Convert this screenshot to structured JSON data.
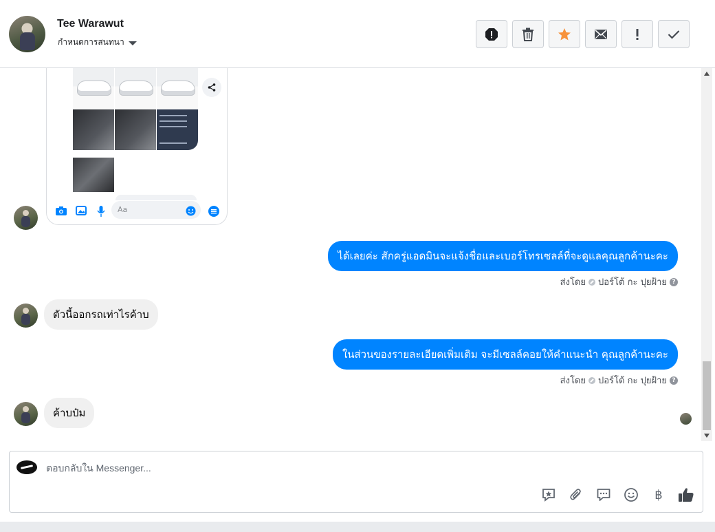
{
  "header": {
    "name": "Tee Warawut",
    "subtitle": "กำหนดการสนทนา",
    "tools": [
      {
        "icon": "alert-icon"
      },
      {
        "icon": "trash-icon"
      },
      {
        "icon": "star-icon",
        "color": "#f7923b"
      },
      {
        "icon": "envelope-icon"
      },
      {
        "icon": "exclamation-icon"
      },
      {
        "icon": "checkmark-icon"
      }
    ]
  },
  "attachment": {
    "input_placeholder": "Aa"
  },
  "messages": [
    {
      "direction": "out",
      "text": "ได้เลยค่ะ สักครู่แอดมินจะแจ้งชื่อและเบอร์โทรเซลล์ที่จะดูแลคุณลูกค้านะคะ",
      "sent_by": "ส่งโดย",
      "sender": "ปอร์โต้ กะ ปุยฝ้าย"
    },
    {
      "direction": "in",
      "text": "ตัวนี้ออกรถเท่าไรค้าบ"
    },
    {
      "direction": "out",
      "text": "ในส่วนของรายละเอียดเพิ่มเติม จะมีเซลล์คอยให้คำแนะนำ คุณลูกค้านะคะ",
      "sent_by": "ส่งโดย",
      "sender": "ปอร์โต้ กะ ปุยฝ้าย"
    },
    {
      "direction": "in",
      "text": "ค้าบป๋ม"
    }
  ],
  "composer": {
    "placeholder": "ตอบกลับใน Messenger...",
    "tools": [
      "saved-reply-icon",
      "attachment-icon",
      "comment-icon",
      "emoji-icon",
      "baht-icon",
      "thumbs-up-icon"
    ],
    "baht_symbol": "฿"
  },
  "colors": {
    "accent": "#0084ff",
    "incoming_bubble": "#f0f0f0"
  }
}
